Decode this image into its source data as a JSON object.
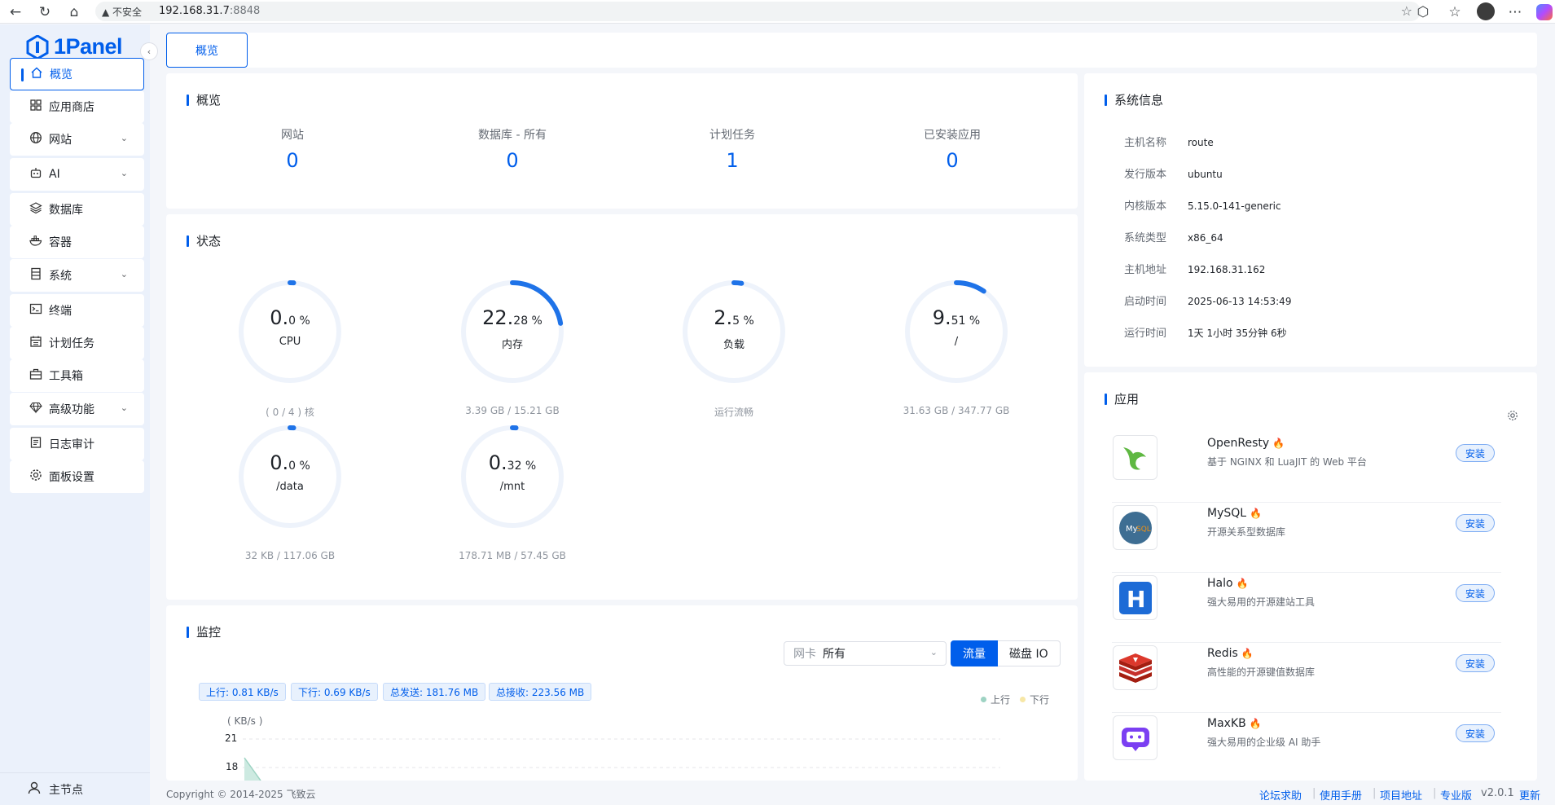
{
  "browser": {
    "insecure_label": "不安全",
    "url_host": "192.168.31.7",
    "url_port": ":8848"
  },
  "brand": {
    "logo_text": "1Panel",
    "accent": "#005eeb"
  },
  "sidebar": {
    "items": [
      {
        "label": "概览",
        "icon": "home-icon"
      },
      {
        "label": "应用商店",
        "icon": "grid-icon"
      },
      {
        "label": "网站",
        "icon": "globe-icon"
      },
      {
        "label": "AI",
        "icon": "robot-icon"
      },
      {
        "label": "数据库",
        "icon": "layers-icon"
      },
      {
        "label": "容器",
        "icon": "docker-icon"
      },
      {
        "label": "系统",
        "icon": "server-icon"
      },
      {
        "label": "终端",
        "icon": "terminal-icon"
      },
      {
        "label": "计划任务",
        "icon": "calendar-icon"
      },
      {
        "label": "工具箱",
        "icon": "toolbox-icon"
      },
      {
        "label": "高级功能",
        "icon": "diamond-icon"
      },
      {
        "label": "日志审计",
        "icon": "log-icon"
      },
      {
        "label": "面板设置",
        "icon": "gear-icon"
      }
    ],
    "node_label": "主节点"
  },
  "tabs": {
    "active": "概览"
  },
  "overview": {
    "title": "概览",
    "stats": [
      {
        "label": "网站",
        "value": "0"
      },
      {
        "label": "数据库 - 所有",
        "value": "0"
      },
      {
        "label": "计划任务",
        "value": "1"
      },
      {
        "label": "已安装应用",
        "value": "0"
      }
    ]
  },
  "status": {
    "title": "状态",
    "gauges": [
      {
        "int": "0.",
        "dec": "0 %",
        "name": "CPU",
        "sub": "( 0 / 4 ) 核",
        "percent": 0
      },
      {
        "int": "22.",
        "dec": "28 %",
        "name": "内存",
        "sub": "3.39 GB / 15.21 GB",
        "percent": 22.28
      },
      {
        "int": "2.",
        "dec": "5 %",
        "name": "负载",
        "sub": "运行流畅",
        "percent": 2.5
      },
      {
        "int": "9.",
        "dec": "51 %",
        "name": "/",
        "sub": "31.63 GB / 347.77 GB",
        "percent": 9.51
      },
      {
        "int": "0.",
        "dec": "0 %",
        "name": "/data",
        "sub": "32 KB / 117.06 GB",
        "percent": 0
      },
      {
        "int": "0.",
        "dec": "32 %",
        "name": "/mnt",
        "sub": "178.71 MB / 57.45 GB",
        "percent": 0.32
      }
    ]
  },
  "monitor": {
    "title": "监控",
    "nic_label": "网卡",
    "nic_value": "所有",
    "traffic_btn": "流量",
    "disk_btn": "磁盘 IO",
    "tags": [
      "上行: 0.81 KB/s",
      "下行: 0.69 KB/s",
      "总发送: 181.76 MB",
      "总接收: 223.56 MB"
    ],
    "legend_up": "上行",
    "legend_down": "下行",
    "unit": "( KB/s )",
    "y_ticks": [
      "21",
      "18"
    ]
  },
  "sysinfo": {
    "title": "系统信息",
    "rows": [
      {
        "key": "主机名称",
        "value": "route"
      },
      {
        "key": "发行版本",
        "value": "ubuntu"
      },
      {
        "key": "内核版本",
        "value": "5.15.0-141-generic"
      },
      {
        "key": "系统类型",
        "value": "x86_64"
      },
      {
        "key": "主机地址",
        "value": "192.168.31.162"
      },
      {
        "key": "启动时间",
        "value": "2025-06-13 14:53:49"
      },
      {
        "key": "运行时间",
        "value": "1天 1小时 35分钟 6秒"
      }
    ]
  },
  "apps": {
    "title": "应用",
    "install_label": "安装",
    "items": [
      {
        "name": "OpenResty",
        "desc": "基于 NGINX 和 LuaJIT 的 Web 平台",
        "icon": "openresty-icon"
      },
      {
        "name": "MySQL",
        "desc": "开源关系型数据库",
        "icon": "mysql-icon"
      },
      {
        "name": "Halo",
        "desc": "强大易用的开源建站工具",
        "icon": "halo-icon"
      },
      {
        "name": "Redis",
        "desc": "高性能的开源键值数据库",
        "icon": "redis-icon"
      },
      {
        "name": "MaxKB",
        "desc": "强大易用的企业级 AI 助手",
        "icon": "maxkb-icon"
      }
    ]
  },
  "footer": {
    "copyright": "Copyright © 2014-2025 飞致云",
    "links": [
      "论坛求助",
      "使用手册",
      "项目地址"
    ],
    "edition": "专业版",
    "version": "v2.0.1",
    "update": "更新"
  }
}
